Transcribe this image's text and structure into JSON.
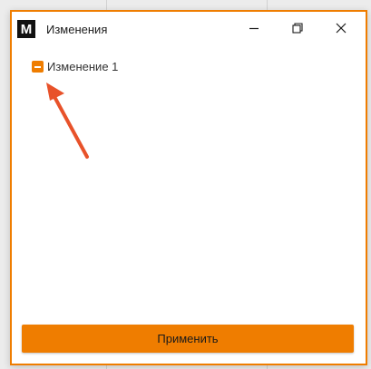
{
  "window": {
    "title": "Изменения",
    "logo_letter": "M",
    "accent_color": "#ef7d00"
  },
  "titlebar_buttons": [
    {
      "name": "minimize",
      "icon": "minimize-icon"
    },
    {
      "name": "maximize",
      "icon": "restore-icon"
    },
    {
      "name": "close",
      "icon": "close-icon"
    }
  ],
  "tree": {
    "items": [
      {
        "label": "Изменение 1",
        "state": "indeterminate"
      }
    ]
  },
  "annotation": {
    "icon": "arrow-icon",
    "color": "#e8522a"
  },
  "footer": {
    "apply_label": "Применить"
  }
}
